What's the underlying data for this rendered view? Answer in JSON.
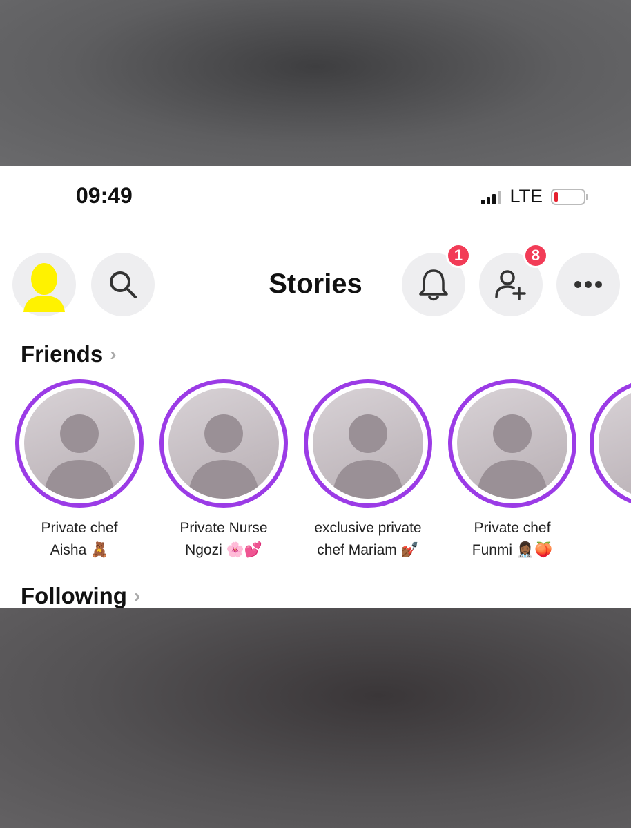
{
  "status_bar": {
    "time": "09:49",
    "network": "LTE"
  },
  "header": {
    "title": "Stories",
    "notifications_badge": "1",
    "add_friend_badge": "8",
    "icons": [
      "avatar-icon",
      "search-icon",
      "bell-icon",
      "add-friend-icon",
      "more-icon"
    ]
  },
  "friends": {
    "title": "Friends",
    "stories": [
      {
        "line1": "Private chef",
        "line2": "Aisha 🧸"
      },
      {
        "line1": "Private Nurse",
        "line2": "Ngozi 🌸💕"
      },
      {
        "line1": "exclusive private",
        "line2": "chef Mariam 💅🏾"
      },
      {
        "line1": "Private chef",
        "line2": "Funmi 👩🏾‍⚕️🍑"
      }
    ]
  },
  "following": {
    "title": "Following"
  },
  "colors": {
    "story_ring": "#9b3be6",
    "badge": "#f23c57",
    "avatar": "#fff200",
    "battery_low": "#e5202e"
  }
}
